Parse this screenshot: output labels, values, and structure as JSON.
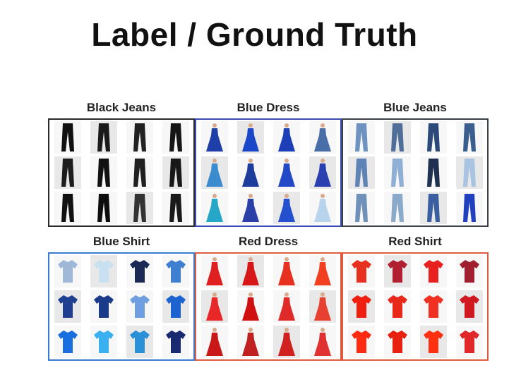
{
  "title": "Label / Ground Truth",
  "panels": [
    {
      "label": "Black Jeans",
      "kind": "pants",
      "border": "#2a2a2a",
      "colors": [
        "#111111",
        "#1a1a1a",
        "#222222",
        "#151515",
        "#1c1c1c",
        "#111111",
        "#202020",
        "#181818",
        "#111111",
        "#0d0d0d",
        "#333333",
        "#1a1a1a"
      ]
    },
    {
      "label": "Blue Dress",
      "kind": "dress",
      "border": "#3a4db5",
      "colors": [
        "#1f3fa8",
        "#1b48c8",
        "#1c3fb8",
        "#4a6fa8",
        "#3a8ccf",
        "#1e3c9c",
        "#2348c8",
        "#2a3fb0",
        "#27a7c8",
        "#2a3fa8",
        "#2450d0",
        "#b7d4ec"
      ]
    },
    {
      "label": "Blue Jeans",
      "kind": "pants",
      "border": "#3a3f45",
      "colors": [
        "#6f93c0",
        "#4f6f99",
        "#2b4a7a",
        "#3a5f8f",
        "#5d84b5",
        "#8fb0d4",
        "#1f3050",
        "#a8c4e0",
        "#6f90b8",
        "#8aa9cb",
        "#3a5fa0",
        "#2040c0"
      ]
    },
    {
      "label": "Blue Shirt",
      "kind": "shirt",
      "border": "#3a7bd0",
      "colors": [
        "#9fb8d8",
        "#c8e0f0",
        "#1a2a55",
        "#3f7fd0",
        "#1f3f90",
        "#1a3a8a",
        "#6f9fe0",
        "#1d63d0",
        "#1a6fe0",
        "#3ab0f0",
        "#2a90d8",
        "#1a2a70"
      ]
    },
    {
      "label": "Red Dress",
      "kind": "dress",
      "border": "#e05a40",
      "colors": [
        "#e02020",
        "#d81818",
        "#e83020",
        "#f04020",
        "#e82828",
        "#d01010",
        "#e02a2a",
        "#e84030",
        "#c81818",
        "#c02020",
        "#d02020",
        "#e03030"
      ]
    },
    {
      "label": "Red Shirt",
      "kind": "shirt",
      "border": "#e05a40",
      "colors": [
        "#e83020",
        "#b02030",
        "#e82020",
        "#a02030",
        "#f02010",
        "#e82818",
        "#f03020",
        "#d01820",
        "#ff2a10",
        "#e82010",
        "#ff3010",
        "#e02828"
      ]
    }
  ]
}
